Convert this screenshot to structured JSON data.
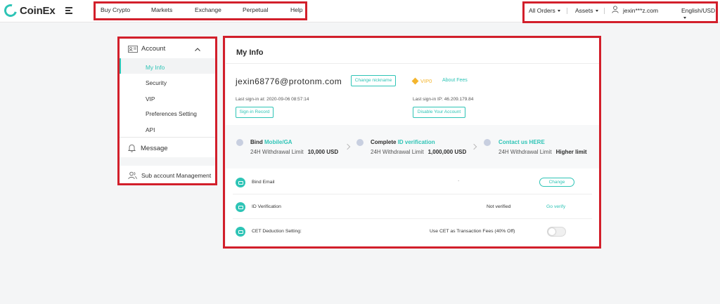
{
  "header": {
    "logo_text": "CoinEx",
    "nav": [
      "Buy Crypto",
      "Markets",
      "Exchange",
      "Perpetual",
      "Help"
    ],
    "all_orders": "All Orders",
    "assets": "Assets",
    "user": "jexin***z.com",
    "language": "English/USD"
  },
  "sidebar": {
    "account": "Account",
    "items": [
      "My Info",
      "Security",
      "VIP",
      "Preferences Setting",
      "API"
    ],
    "message": "Message",
    "sub_account": "Sub account Management"
  },
  "main": {
    "title": "My Info",
    "nickname": "jexin68776@protonm.com",
    "change_nickname": "Change nickname",
    "vip_level": "VIP0",
    "about_fees": "About Fees",
    "last_signin_at": "Last sign-in at: 2020-09-06 08:57:14",
    "last_signin_ip": "Last sign-in IP: 46.209.179.84",
    "signin_record": "Sign-in Record",
    "disable_account": "Disable Your Account",
    "steps": [
      {
        "title_prefix": "Bind",
        "title_highlight": "Mobile/GA",
        "limit_label": "24H Withdrawal Limit",
        "limit_value": "10,000 USD"
      },
      {
        "title_prefix": "Complete",
        "title_highlight": "ID verification",
        "limit_label": "24H Withdrawal Limit",
        "limit_value": "1,000,000 USD"
      },
      {
        "title_prefix": "",
        "title_highlight": "Contact us HERE",
        "limit_label": "24H Withdrawal Limit",
        "limit_value": "Higher limit"
      }
    ],
    "rows": {
      "email_label": "Bind Email",
      "email_value": "·",
      "change": "Change",
      "id_label": "ID Verification",
      "id_status": "Not verified",
      "go_verify": "Go verify",
      "cet_label": "CET Deduction Setting:",
      "cet_desc": "Use CET as Transaction Fees (40% Off)"
    }
  },
  "colors": {
    "accent": "#2ec4b6",
    "highlight_box": "#d21f2b",
    "vip": "#f4b52d"
  }
}
